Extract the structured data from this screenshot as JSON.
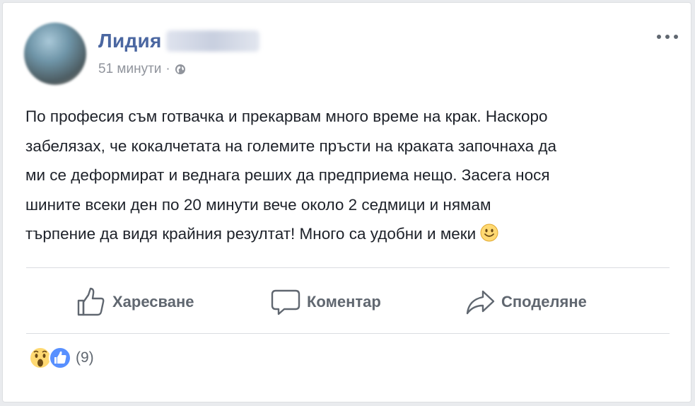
{
  "post": {
    "author": {
      "name": "Лидия"
    },
    "time": "51 минути",
    "separator": "·",
    "text": "По професия съм готвачка и прекарвам много време на крак. Наскоро\nзабелязах, че кокалчетата на големите пръсти на краката започнаха да\nми се деформират и веднага реших да предприема нещо. Засега нося\nшините всеки ден по 20 минути вече около 2 седмици и нямам\nтърпение да видя крайния резултат! Много са удобни и меки"
  },
  "actions": {
    "like_label": "Харесване",
    "comment_label": "Коментар",
    "share_label": "Споделяне"
  },
  "reactions": {
    "types": [
      "wow",
      "like"
    ],
    "count": "(9)"
  },
  "icons": {
    "avatar": "avatar",
    "privacy": "globe-icon",
    "more": "more-options-icon",
    "like": "thumbs-up-icon",
    "comment": "comment-bubble-icon",
    "share": "share-arrow-icon",
    "smile": "smile-emoji-icon"
  },
  "colors": {
    "author": "#4b67a1",
    "text": "#1d2129",
    "meta": "#90949c",
    "action": "#606770",
    "like_blue": "#5890ff",
    "wow_yellow": "#ffd972"
  }
}
